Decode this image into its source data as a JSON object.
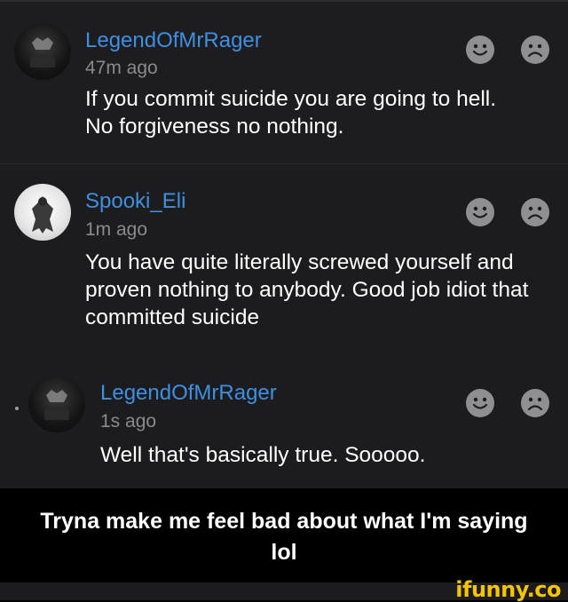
{
  "comments": [
    {
      "username": "LegendOfMrRager",
      "time": "47m ago",
      "body": "If you commit suicide you are going to hell. No forgiveness no nothing.",
      "reactions": [
        "smile-icon",
        "frown-icon"
      ]
    },
    {
      "username": "Spooki_Eli",
      "time": "1m ago",
      "body": "You have quite literally screwed yourself and proven nothing to anybody. Good job idiot that committed suicide",
      "reactions": [
        "smile-icon",
        "frown-icon"
      ]
    },
    {
      "username": "LegendOfMrRager",
      "time": "1s ago",
      "body": "Well that's basically true. Sooooo.",
      "reactions": [
        "smile-icon",
        "frown-icon"
      ]
    }
  ],
  "caption": "Tryna make me feel bad about what I'm saying lol",
  "watermark": "ifunny.co",
  "colors": {
    "username": "#3f8fe0",
    "background": "#1c1c1e",
    "watermark": "#f4c400"
  }
}
